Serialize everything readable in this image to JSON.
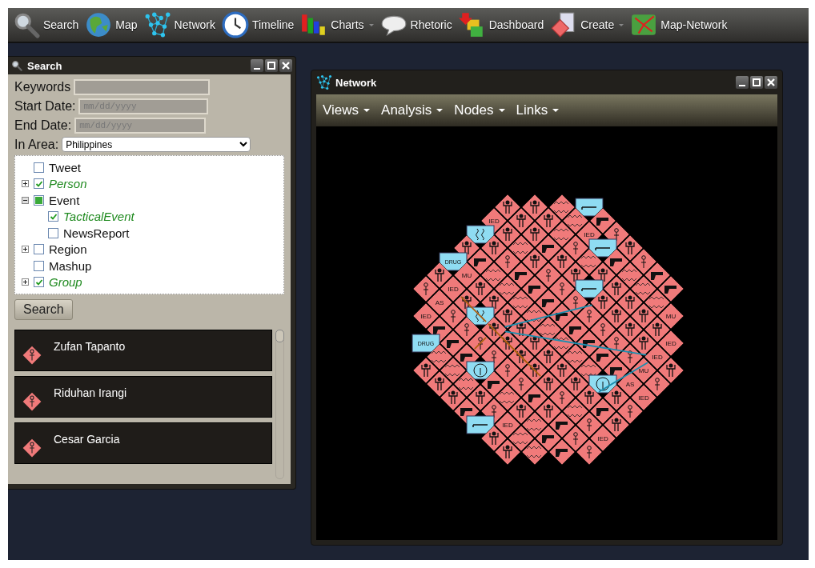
{
  "toolbar": {
    "items": [
      {
        "label": "Search",
        "menu": false
      },
      {
        "label": "Map",
        "menu": false
      },
      {
        "label": "Network",
        "menu": false
      },
      {
        "label": "Timeline",
        "menu": false
      },
      {
        "label": "Charts",
        "menu": true
      },
      {
        "label": "Rhetoric",
        "menu": false
      },
      {
        "label": "Dashboard",
        "menu": false
      },
      {
        "label": "Create",
        "menu": true
      },
      {
        "label": "Map-Network",
        "menu": false
      }
    ]
  },
  "search_panel": {
    "title": "Search",
    "fields": [
      {
        "label": "Keywords"
      },
      {
        "label": "Start Date:",
        "placeholder": "mm/dd/yyyy"
      },
      {
        "label": "End Date:",
        "placeholder": "mm/dd/yyyy"
      }
    ],
    "area": {
      "label": "In Area:",
      "value": "Philippines"
    },
    "tree": [
      {
        "label": "Tweet",
        "checked": false,
        "partial": false,
        "expandable": false,
        "expanded": false
      },
      {
        "label": "Person",
        "checked": true,
        "partial": false,
        "expandable": true,
        "expanded": false
      },
      {
        "label": "Event",
        "checked": false,
        "partial": true,
        "expandable": true,
        "expanded": true,
        "children": [
          {
            "label": "TacticalEvent",
            "checked": true,
            "partial": false,
            "expandable": false,
            "expanded": false
          },
          {
            "label": "NewsReport",
            "checked": false,
            "partial": false,
            "expandable": false,
            "expanded": false
          }
        ]
      },
      {
        "label": "Region",
        "checked": false,
        "partial": false,
        "expandable": true,
        "expanded": false
      },
      {
        "label": "Mashup",
        "checked": false,
        "partial": false,
        "expandable": false,
        "expanded": false
      },
      {
        "label": "Group",
        "checked": true,
        "partial": false,
        "expandable": true,
        "expanded": false
      }
    ],
    "button": "Search",
    "results": [
      {
        "name": "Zufan Tapanto"
      },
      {
        "name": "Riduhan Irangi"
      },
      {
        "name": "Cesar Garcia"
      }
    ]
  },
  "network_window": {
    "title": "Network",
    "menus": [
      "Views",
      "Analysis",
      "Nodes",
      "Links"
    ],
    "node_labels": [
      {
        "kind": "event",
        "text": "IED"
      },
      {
        "kind": "event",
        "text": "IED"
      },
      {
        "kind": "drug",
        "text": "DRUG"
      },
      {
        "kind": "event",
        "text": "MU"
      },
      {
        "kind": "event",
        "text": "IED"
      },
      {
        "kind": "event",
        "text": "AS"
      },
      {
        "kind": "event",
        "text": "IED"
      },
      {
        "kind": "event",
        "text": "MU"
      },
      {
        "kind": "drug",
        "text": "DRUG"
      },
      {
        "kind": "event",
        "text": "IED"
      },
      {
        "kind": "event",
        "text": "IED"
      },
      {
        "kind": "event",
        "text": "MU"
      },
      {
        "kind": "event",
        "text": "AS"
      },
      {
        "kind": "event",
        "text": "IED"
      },
      {
        "kind": "event",
        "text": "IED"
      },
      {
        "kind": "event",
        "text": "IED"
      }
    ]
  }
}
